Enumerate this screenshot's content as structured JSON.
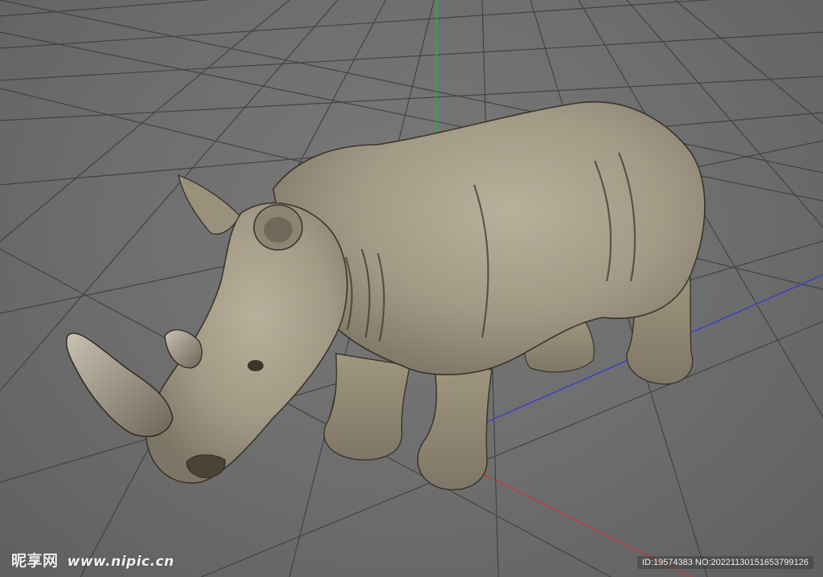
{
  "viewport": {
    "name": "3D viewport",
    "background_color": "#6d6d6d",
    "grid_color": "#3c3c3c",
    "axes": {
      "x_axis_color": "#c23b3b",
      "y_axis_color": "#2fae3a",
      "z_axis_color": "#3a3fc7"
    },
    "object": {
      "type": "rhino model",
      "skin_color": "#a39a86",
      "shadow_color": "#4a4438"
    }
  },
  "watermark": {
    "logo_text": "昵享网",
    "site": "www.nipic.cn",
    "id_text": "ID:19574383 NO:20221130151653799126"
  }
}
